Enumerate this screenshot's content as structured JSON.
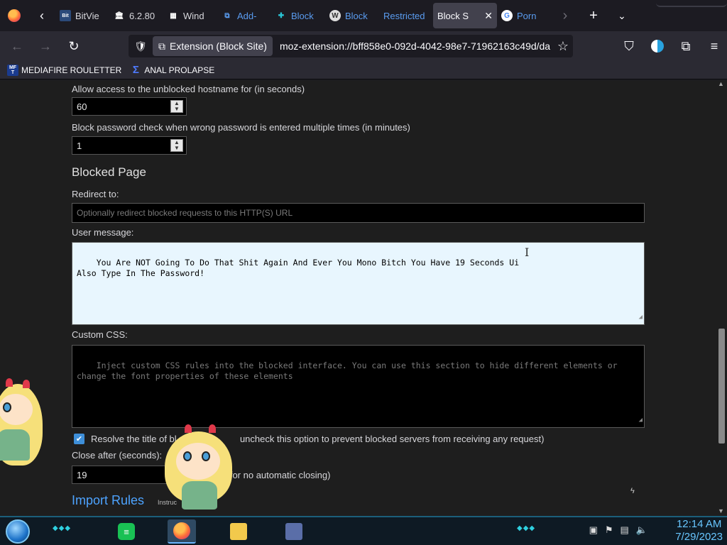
{
  "browser": {
    "tabs": [
      {
        "label": "BitVie",
        "icon": "bitview-icon"
      },
      {
        "label": "6.2.80",
        "icon": "bank-icon"
      },
      {
        "label": "Wind",
        "icon": "building-icon"
      },
      {
        "label": "Add-",
        "icon": "puzzle-icon"
      },
      {
        "label": "Block",
        "icon": "puzzle-cyan-icon"
      },
      {
        "label": "Block",
        "icon": "w-icon"
      },
      {
        "label": "Restricted",
        "icon": "none"
      },
      {
        "label": "Block S",
        "icon": "none",
        "active": true
      },
      {
        "label": "Porn",
        "icon": "google-icon"
      }
    ],
    "url_chip": "Extension (Block Site)",
    "url": "moz-extension://bff858e0-092d-4042-98e7-71962163c49d/da",
    "bookmarks": [
      {
        "label": "MEDIAFIRE ROULETTER",
        "icon_text": "MF T"
      },
      {
        "label": "ANAL PROLAPSE",
        "icon_text": "Σ"
      }
    ]
  },
  "settings": {
    "allow_access_label": "Allow access to the unblocked hostname for (in seconds)",
    "allow_access_value": "60",
    "block_password_label": "Block password check when wrong password is entered multiple times (in minutes)",
    "block_password_value": "1",
    "blocked_page_heading": "Blocked Page",
    "redirect_label": "Redirect to:",
    "redirect_placeholder": "Optionally redirect blocked requests to this HTTP(S) URL",
    "user_message_label": "User message:",
    "user_message_value": "You Are NOT Going To Do That Shit Again And Ever You Mono Bitch You Have 19 Seconds Ui\nAlso Type In The Password!",
    "custom_css_label": "Custom CSS:",
    "custom_css_placeholder": "Inject custom CSS rules into the blocked interface. You can use this section to hide different elements or change the font properties of these elements",
    "resolve_title_label_a": "Resolve the title of bl",
    "resolve_title_label_b": "uncheck this option to prevent blocked servers from receiving any request)",
    "resolve_title_checked": true,
    "close_after_label": "Close after (seconds):",
    "close_after_value": "19",
    "close_after_hint": "o for no automatic closing)",
    "import_heading": "Import Rules",
    "import_instr": "Instruc"
  },
  "taskbar": {
    "time": "12:14 AM",
    "date": "7/29/2023"
  }
}
